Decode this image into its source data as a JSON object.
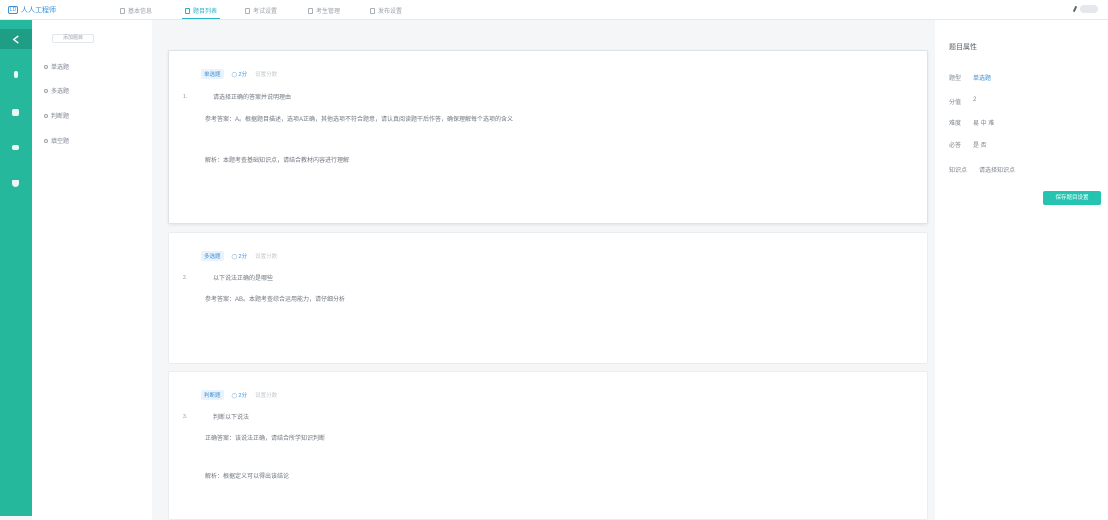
{
  "app": {
    "logo_mark": "LD",
    "title": "人人工程师"
  },
  "tabs": [
    {
      "label": "基本信息",
      "icon": "file-icon"
    },
    {
      "label": "题目列表",
      "icon": "list-icon"
    },
    {
      "label": "考试设置",
      "icon": "settings-icon"
    },
    {
      "label": "考生管理",
      "icon": "user-icon"
    },
    {
      "label": "发布设置",
      "icon": "publish-icon"
    }
  ],
  "rail": [
    "share-icon",
    "music-icon",
    "doc-icon",
    "chat-icon",
    "shield-icon"
  ],
  "sidebar": {
    "header": "添加题目",
    "items": [
      "单选题",
      "多选题",
      "判断题",
      "填空题"
    ]
  },
  "questions": [
    {
      "tag": "单选题",
      "score": "2分",
      "hint": "设置分数",
      "number": "1.",
      "stem": "请选择正确的答案并说明理由",
      "answer_line1": "参考答案：A。根据题目描述，选项A正确，其他选项不符合题意，请认真阅读题干后作答，确保理解每个选项的含义",
      "answer_line2": "解析：本题考查基础知识点，请结合教材内容进行理解"
    },
    {
      "tag": "多选题",
      "score": "2分",
      "hint": "设置分数",
      "number": "2.",
      "stem": "以下说法正确的是哪些",
      "answer_line1": "参考答案：AB。本题考查综合运用能力，请仔细分析"
    },
    {
      "tag": "判断题",
      "score": "2分",
      "hint": "设置分数",
      "number": "3.",
      "stem": "判断以下说法",
      "answer_line1": "正确答案：该说法正确，请结合所学知识判断",
      "answer_line2": "解析：根据定义可以得出该结论"
    }
  ],
  "panel": {
    "title": "题目属性",
    "rows": [
      {
        "label": "题型",
        "value": "单选题"
      },
      {
        "label": "分值",
        "value": "2"
      },
      {
        "label": "难度",
        "value": "易 中 难"
      },
      {
        "label": "必答",
        "value": "是 否"
      },
      {
        "label": "知识点",
        "value": "请选择知识点"
      }
    ],
    "button": "保存题目设置"
  },
  "colors": {
    "accent": "#26b89c",
    "link": "#3a8fd6"
  }
}
